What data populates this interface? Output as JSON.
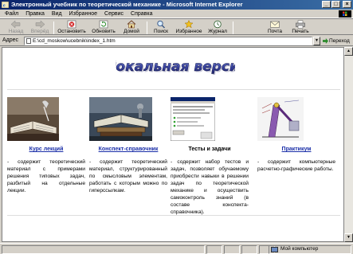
{
  "window": {
    "title": "Электронный учебник по теоретической механике - Microsoft Internet Explorer",
    "controls": {
      "minimize": "_",
      "maximize": "□",
      "close": "×"
    }
  },
  "menu": [
    "Файл",
    "Правка",
    "Вид",
    "Избранное",
    "Сервис",
    "Справка"
  ],
  "toolbar": {
    "back": "Назад",
    "forward": "Вперёд",
    "stop": "Остановить",
    "refresh": "Обновить",
    "home": "Домой",
    "search": "Поиск",
    "favorites": "Избранное",
    "history": "Журнал",
    "mail": "Почта",
    "print": "Печать"
  },
  "address": {
    "label": "Адрес",
    "value": "E:\\cd_moskow\\ucebnik\\index_1.htm",
    "go": "Переход"
  },
  "page": {
    "logo_text": "Локальная версия",
    "columns": [
      {
        "heading": "Курс лекций",
        "is_link": true,
        "description": "- содержит теоретический материал с примерами решения типовых задач, разбитый на отдельные лекции."
      },
      {
        "heading": "Конспект-справочник",
        "is_link": true,
        "description": "- содержит теоретический материал, структурированный по смысловым элементам, работать с которым можно по гиперссылкам."
      },
      {
        "heading": "Тесты и задачи",
        "is_link": false,
        "description": "- содержит набор тестов и задач, позволяет обучаемому приобрести навыки в решении задач по теоретической механике и осуществить самоконтроль знаний (в составе конспекта-справочника)."
      },
      {
        "heading": "Практикум",
        "is_link": true,
        "description": "- содержит компьютерные расчетно-графические работы."
      }
    ]
  },
  "status": {
    "zone": "Мой компьютер"
  },
  "colors": {
    "title_gradient_start": "#0a246a",
    "title_gradient_end": "#3a6ea5",
    "link": "#1a2ea8",
    "chrome": "#d4d0c8"
  }
}
